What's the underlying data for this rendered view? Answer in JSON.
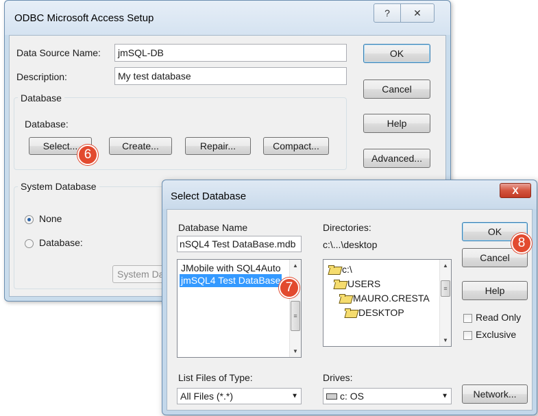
{
  "odbc": {
    "title": "ODBC Microsoft Access Setup",
    "help_caption": "?",
    "close_caption": "✕",
    "data_source_label": "Data Source Name:",
    "data_source_value": "jmSQL-DB",
    "description_label": "Description:",
    "description_value": "My test database",
    "database_group": "Database",
    "database_label": "Database:",
    "buttons": {
      "select": "Select...",
      "create": "Create...",
      "repair": "Repair...",
      "compact": "Compact...",
      "ok": "OK",
      "cancel": "Cancel",
      "help": "Help",
      "advanced": "Advanced..."
    },
    "system_db_group": "System Database",
    "radio_none": "None",
    "radio_database": "Database:",
    "system_db_button": "System Dat",
    "selected_radio": "None"
  },
  "select_db": {
    "title": "Select Database",
    "close_caption": "X",
    "db_name_label": "Database Name",
    "db_name_value": "nSQL4 Test DataBase.mdb",
    "files": [
      "JMobile with SQL4Auto",
      "jmSQL4 Test DataBase"
    ],
    "selected_file": "jmSQL4 Test DataBase",
    "directories_label": "Directories:",
    "current_dir": "c:\\...\\desktop",
    "dirs": [
      "c:\\",
      "USERS",
      "MAURO.CRESTA",
      "DESKTOP"
    ],
    "list_type_label": "List Files of Type:",
    "list_type_value": "All Files (*.*)",
    "drives_label": "Drives:",
    "drives_value": "c: OS",
    "buttons": {
      "ok": "OK",
      "cancel": "Cancel",
      "help": "Help",
      "network": "Network..."
    },
    "read_only": "Read Only",
    "exclusive": "Exclusive"
  },
  "steps": [
    "6",
    "7",
    "8"
  ],
  "colors": {
    "step_badge": "#e24a2f",
    "selection": "#3399ff",
    "close_button": "#c23a25"
  }
}
